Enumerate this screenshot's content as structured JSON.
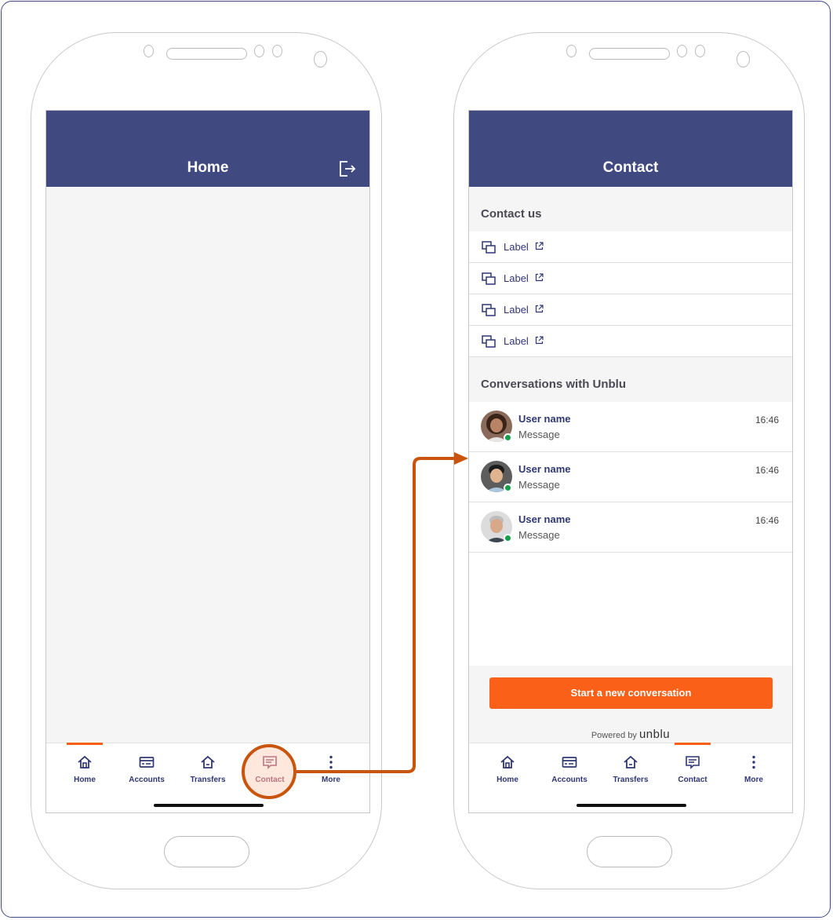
{
  "left_screen": {
    "title": "Home",
    "tabs": [
      {
        "label": "Home",
        "icon": "home-icon",
        "active": true
      },
      {
        "label": "Accounts",
        "icon": "card-icon",
        "active": false
      },
      {
        "label": "Transfers",
        "icon": "transfer-icon",
        "active": false
      },
      {
        "label": "Contact",
        "icon": "chat-icon",
        "active": false,
        "highlighted": true
      },
      {
        "label": "More",
        "icon": "more-vertical-icon",
        "active": false
      }
    ]
  },
  "right_screen": {
    "title": "Contact",
    "contact_section": {
      "header": "Contact us",
      "items": [
        {
          "label": "Label",
          "icon": "copy-icon",
          "trailing_icon": "external-link-icon"
        },
        {
          "label": "Label",
          "icon": "copy-icon",
          "trailing_icon": "external-link-icon"
        },
        {
          "label": "Label",
          "icon": "copy-icon",
          "trailing_icon": "external-link-icon"
        },
        {
          "label": "Label",
          "icon": "copy-icon",
          "trailing_icon": "external-link-icon"
        }
      ]
    },
    "conversations_section": {
      "header": "Conversations with Unblu",
      "items": [
        {
          "user": "User name",
          "message": "Message",
          "time": "16:46",
          "status": "online"
        },
        {
          "user": "User name",
          "message": "Message",
          "time": "16:46",
          "status": "online"
        },
        {
          "user": "User name",
          "message": "Message",
          "time": "16:46",
          "status": "online"
        }
      ]
    },
    "cta_label": "Start a new conversation",
    "powered_by": "Powered by",
    "brand": "unblu",
    "tabs": [
      {
        "label": "Home",
        "icon": "home-icon",
        "active": false
      },
      {
        "label": "Accounts",
        "icon": "card-icon",
        "active": false
      },
      {
        "label": "Transfers",
        "icon": "transfer-icon",
        "active": false
      },
      {
        "label": "Contact",
        "icon": "chat-icon",
        "active": true
      },
      {
        "label": "More",
        "icon": "more-vertical-icon",
        "active": false
      }
    ]
  },
  "colors": {
    "header": "#414a80",
    "accent": "#fb6019",
    "connector": "#c9540b",
    "online": "#12a14a",
    "text_primary": "#2f3773"
  }
}
